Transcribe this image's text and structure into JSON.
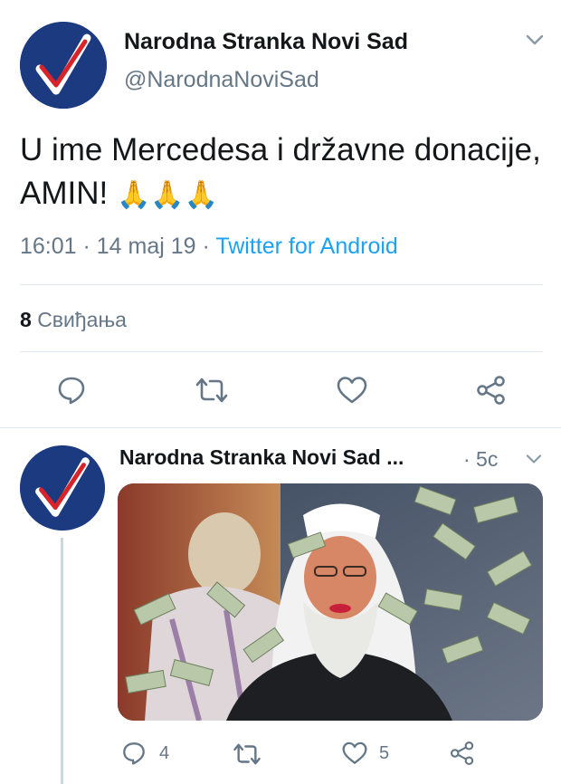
{
  "main_tweet": {
    "display_name": "Narodna Stranka Novi Sad",
    "handle": "@NarodnaNoviSad",
    "text": "U ime Mercedesa i državne donacije, AMIN!",
    "emoji": "🙏🙏🙏",
    "time": "16:01",
    "date_sep": " · ",
    "date": "14 maj 19",
    "source_sep": " · ",
    "source": "Twitter for Android",
    "likes_count": "8",
    "likes_label": "Свиђања"
  },
  "reply_tweet": {
    "display_name": "Narodna Stranka Novi Sad ...",
    "time_ago": "· 5с",
    "reply_count": "4",
    "like_count": "5"
  },
  "colors": {
    "accent": "#1da1f2",
    "avatar_bg": "#1c3a80",
    "checkmark": "#d8232a",
    "muted": "#657786"
  },
  "icons": [
    "checkmark-logo-icon",
    "chevron-down-icon",
    "reply-icon",
    "retweet-icon",
    "heart-icon",
    "share-icon"
  ]
}
